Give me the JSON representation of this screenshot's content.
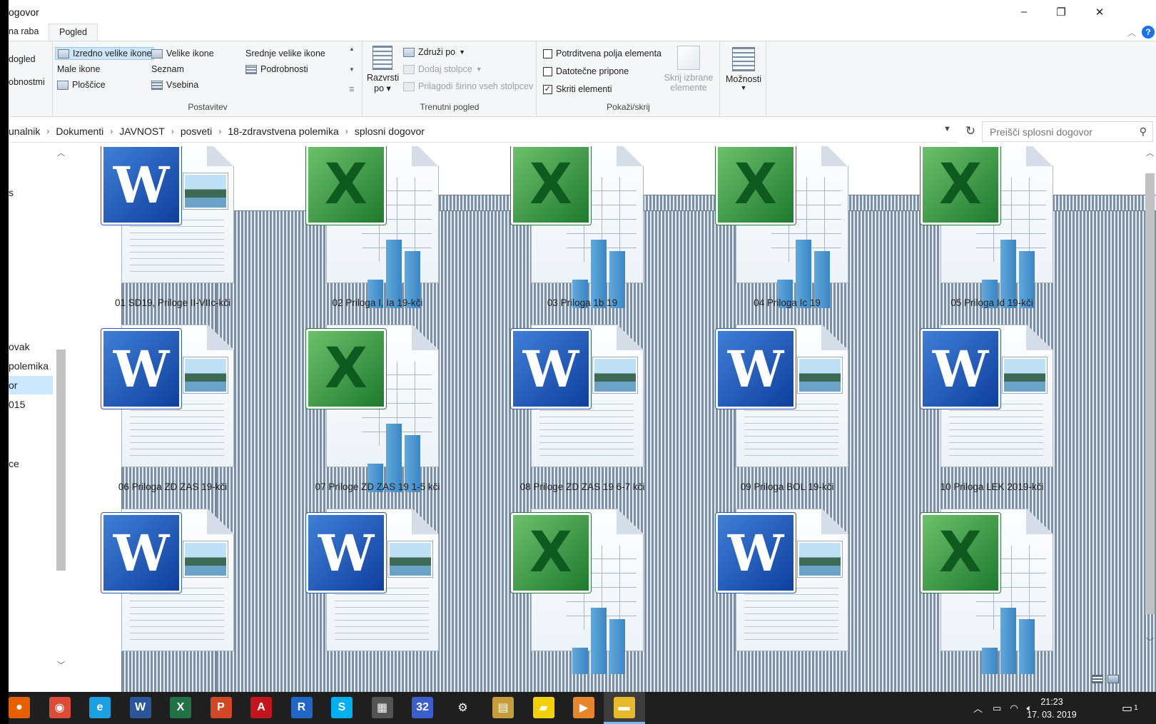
{
  "window": {
    "title": "ogovor",
    "controls": {
      "minimize": "–",
      "maximize": "❐",
      "close": "✕"
    }
  },
  "ribbon": {
    "tabs": [
      {
        "label": "na raba",
        "active": false
      },
      {
        "label": "Pogled",
        "active": true
      }
    ],
    "help": "?",
    "panes_group": {
      "items": [
        "dogled",
        "obnostmi"
      ]
    },
    "layout_group": {
      "label": "Postavitev",
      "options": [
        {
          "label": "Izredno velike ikone",
          "selected": true
        },
        {
          "label": "Velike ikone",
          "selected": false
        },
        {
          "label": "Srednje velike ikone",
          "selected": false
        },
        {
          "label": "Male ikone",
          "selected": false
        },
        {
          "label": "Seznam",
          "selected": false
        },
        {
          "label": "Podrobnosti",
          "selected": false
        },
        {
          "label": "Ploščice",
          "selected": false
        },
        {
          "label": "Vsebina",
          "selected": false
        }
      ]
    },
    "current_view_group": {
      "label": "Trenutni pogled",
      "sort_label_1": "Razvrsti",
      "sort_label_2": "po",
      "group_by": "Združi po",
      "add_columns": "Dodaj stolpce",
      "fit_columns": "Prilagodi širino vseh stolpcev"
    },
    "show_hide_group": {
      "label": "Pokaži/skrij",
      "checkboxes": [
        {
          "label": "Potrditvena polja elementa",
          "checked": false
        },
        {
          "label": "Datotečne pripone",
          "checked": false
        },
        {
          "label": "Skriti elementi",
          "checked": true
        }
      ],
      "hide_selected_1": "Skrij izbrane",
      "hide_selected_2": "elemente"
    },
    "options_label": "Možnosti"
  },
  "address": {
    "crumbs": [
      "unalnik",
      "Dokumenti",
      "JAVNOST",
      "posveti",
      "18-zdravstvena polemika",
      "splosni dogovor"
    ],
    "search_placeholder": "Preišči splosni dogovor"
  },
  "nav": {
    "items": [
      {
        "label": "s",
        "selected": false
      },
      {
        "label": "ovak",
        "selected": false
      },
      {
        "label": "polemika",
        "selected": false
      },
      {
        "label": "or",
        "selected": true
      },
      {
        "label": "015",
        "selected": false
      },
      {
        "label": "ce",
        "selected": false
      }
    ]
  },
  "files": [
    {
      "name": "01 SD19, Priloge II-VIIc-kči",
      "kind": "word"
    },
    {
      "name": "02 Priloga I, Ia 19-kči",
      "kind": "excel"
    },
    {
      "name": "03 Priloga 1b 19",
      "kind": "excel"
    },
    {
      "name": "04 Priloga Ic 19",
      "kind": "excel"
    },
    {
      "name": "05 Priloga Id 19-kči",
      "kind": "excel"
    },
    {
      "name": "06 Priloga ZD ZAS 19-kči",
      "kind": "word"
    },
    {
      "name": "07 Priloge ZD ZAS 19  1-5 kči",
      "kind": "excel"
    },
    {
      "name": "08 Priloge ZD ZAS 19  6-7 kči",
      "kind": "word"
    },
    {
      "name": "09 Priloga BOL 19-kči",
      "kind": "word"
    },
    {
      "name": "10 Priloga LEK 2019-kči",
      "kind": "word"
    },
    {
      "name": "",
      "kind": "word"
    },
    {
      "name": "",
      "kind": "word"
    },
    {
      "name": "",
      "kind": "excel"
    },
    {
      "name": "",
      "kind": "word"
    },
    {
      "name": "",
      "kind": "excel"
    }
  ],
  "taskbar": {
    "apps": [
      {
        "name": "firefox-icon",
        "glyph": "●",
        "color": "#e66000",
        "active": false
      },
      {
        "name": "chrome-icon",
        "glyph": "◉",
        "color": "#dd4b39",
        "active": false
      },
      {
        "name": "internet-explorer-icon",
        "glyph": "e",
        "color": "#1ba1e2",
        "active": false
      },
      {
        "name": "word-icon",
        "glyph": "W",
        "color": "#2b579a",
        "active": false
      },
      {
        "name": "excel-icon",
        "glyph": "X",
        "color": "#217346",
        "active": false
      },
      {
        "name": "powerpoint-icon",
        "glyph": "P",
        "color": "#d24726",
        "active": false
      },
      {
        "name": "acrobat-icon",
        "glyph": "A",
        "color": "#c4151c",
        "active": false
      },
      {
        "name": "r-icon",
        "glyph": "R",
        "color": "#2166c4",
        "active": false
      },
      {
        "name": "skype-icon",
        "glyph": "S",
        "color": "#00aff0",
        "active": false
      },
      {
        "name": "calculator-icon",
        "glyph": "▦",
        "color": "#555555",
        "active": false
      },
      {
        "name": "app-32-icon",
        "glyph": "32",
        "color": "#3a5fcd",
        "active": false
      },
      {
        "name": "settings-icon",
        "glyph": "⚙",
        "color": "#1f1f1f",
        "active": false
      },
      {
        "name": "clipboard-icon",
        "glyph": "▤",
        "color": "#c69c3c",
        "active": false
      },
      {
        "name": "sticky-notes-icon",
        "glyph": "▰",
        "color": "#f2d10a",
        "active": false
      },
      {
        "name": "media-player-icon",
        "glyph": "▶",
        "color": "#e8872a",
        "active": false
      },
      {
        "name": "file-explorer-icon",
        "glyph": "▬",
        "color": "#e8b92a",
        "active": true
      }
    ],
    "time": "21:23",
    "date": "17. 03. 2019",
    "notifications": "1"
  }
}
